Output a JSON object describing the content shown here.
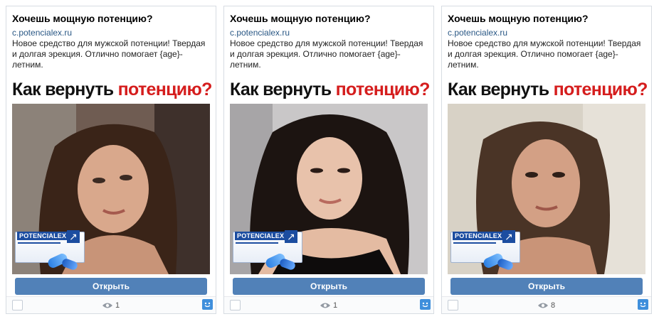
{
  "ads": [
    {
      "title": "Хочешь мощную потенцию?",
      "domain": "c.potencialex.ru",
      "description": "Новое средство для мужской потенции! Твердая и долгая эрекция. Отлично помогает {age}-летним.",
      "headline_black": "Как вернуть ",
      "headline_red": "потенцию?",
      "product_brand": "POTENCIALEX",
      "button_label": "Открыть",
      "views": "1"
    },
    {
      "title": "Хочешь мощную потенцию?",
      "domain": "c.potencialex.ru",
      "description": "Новое средство для мужской потенции! Твердая и долгая эрекция. Отлично помогает {age}-летним.",
      "headline_black": "Как вернуть ",
      "headline_red": "потенцию?",
      "product_brand": "POTENCIALEX",
      "button_label": "Открыть",
      "views": "1"
    },
    {
      "title": "Хочешь мощную потенцию?",
      "domain": "c.potencialex.ru",
      "description": "Новое средство для мужской потенции! Твердая и долгая эрекция. Отлично помогает {age}-летним.",
      "headline_black": "Как вернуть ",
      "headline_red": "потенцию?",
      "product_brand": "POTENCIALEX",
      "button_label": "Открыть",
      "views": "8"
    }
  ],
  "colors": {
    "button": "#5181b8",
    "link": "#2a5885",
    "headline_red": "#d51d1d",
    "smile_icon": "#3f8fdc"
  },
  "icons": [
    "eye-icon",
    "smile-icon",
    "checkbox"
  ]
}
